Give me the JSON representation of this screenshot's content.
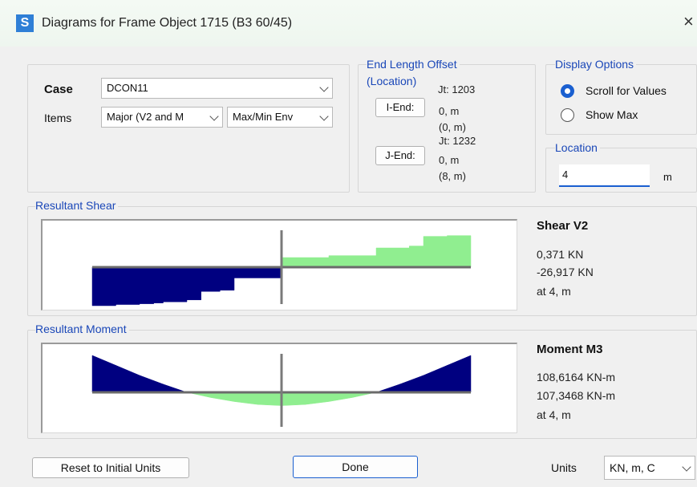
{
  "window": {
    "icon_letter": "S",
    "title": "Diagrams for Frame Object 1715  (B3 60/45)",
    "close_glyph": "×"
  },
  "case_panel": {
    "case_label": "Case",
    "case_value": "DCON11",
    "items_label": "Items",
    "items_value": "Major (V2 and M",
    "env_value": "Max/Min Env"
  },
  "end_offset": {
    "group_label_line1": "End Length Offset",
    "group_label_line2": "(Location)",
    "i_end_button": "I-End:",
    "i_jt": "Jt:  1203",
    "i_offset": "0, m",
    "i_location": "(0, m)",
    "j_end_button": "J-End:",
    "j_jt": "Jt:  1232",
    "j_offset": "0, m",
    "j_location": "(8, m)"
  },
  "display_options": {
    "group_label": "Display Options",
    "scroll_label": "Scroll for Values",
    "showmax_label": "Show Max",
    "selected": "scroll"
  },
  "location": {
    "group_label": "Location",
    "value": "4",
    "unit": "m"
  },
  "shear": {
    "group_label": "Resultant Shear",
    "title": "Shear V2",
    "value1": "0,371 KN",
    "value2": "-26,917 KN",
    "at": "at 4, m"
  },
  "moment": {
    "group_label": "Resultant Moment",
    "title": "Moment M3",
    "value1": "108,6164 KN-m",
    "value2": "107,3468 KN-m",
    "at": "at 4, m"
  },
  "footer": {
    "reset_label": "Reset to Initial Units",
    "done_label": "Done",
    "units_label": "Units",
    "units_value": "KN, m, C"
  },
  "colors": {
    "negative": "#000080",
    "positive": "#90ee90",
    "accent": "#1a5fd0",
    "group_label": "#1a47b8"
  },
  "chart_data": [
    {
      "type": "area",
      "x_range": [
        0,
        8
      ],
      "cursor_x": 4,
      "shear_max_envelope": {
        "x": [
          0,
          0.5,
          0.5,
          1.0,
          1.0,
          1.3,
          1.3,
          1.5,
          1.5,
          2.0,
          2.0,
          2.3,
          2.3,
          2.7,
          2.7,
          3.0,
          3.0,
          4.0,
          4.0,
          5.0,
          5.0,
          6.0,
          6.0,
          6.7,
          6.7,
          7.0,
          7.0,
          7.5,
          7.5,
          8.0
        ],
        "y": [
          -1.0,
          -1.0,
          -0.97,
          -0.97,
          -0.95,
          -0.95,
          -0.93,
          -0.93,
          -0.9,
          -0.9,
          -0.85,
          -0.85,
          -0.63,
          -0.63,
          -0.6,
          -0.6,
          -0.28,
          -0.28,
          0.25,
          0.25,
          0.3,
          0.3,
          0.5,
          0.5,
          0.55,
          0.55,
          0.8,
          0.8,
          0.82,
          0.82
        ]
      },
      "moment_envelope": {
        "x": [
          0,
          0.5,
          1.0,
          1.5,
          2.0,
          2.5,
          3.0,
          3.5,
          4.0,
          4.5,
          5.0,
          5.5,
          6.0,
          6.5,
          7.0,
          7.5,
          8.0
        ],
        "y": [
          1.0,
          0.73,
          0.46,
          0.22,
          0.0,
          -0.14,
          -0.25,
          -0.33,
          -0.36,
          -0.33,
          -0.25,
          -0.14,
          0.0,
          0.22,
          0.46,
          0.73,
          1.0
        ]
      }
    }
  ]
}
